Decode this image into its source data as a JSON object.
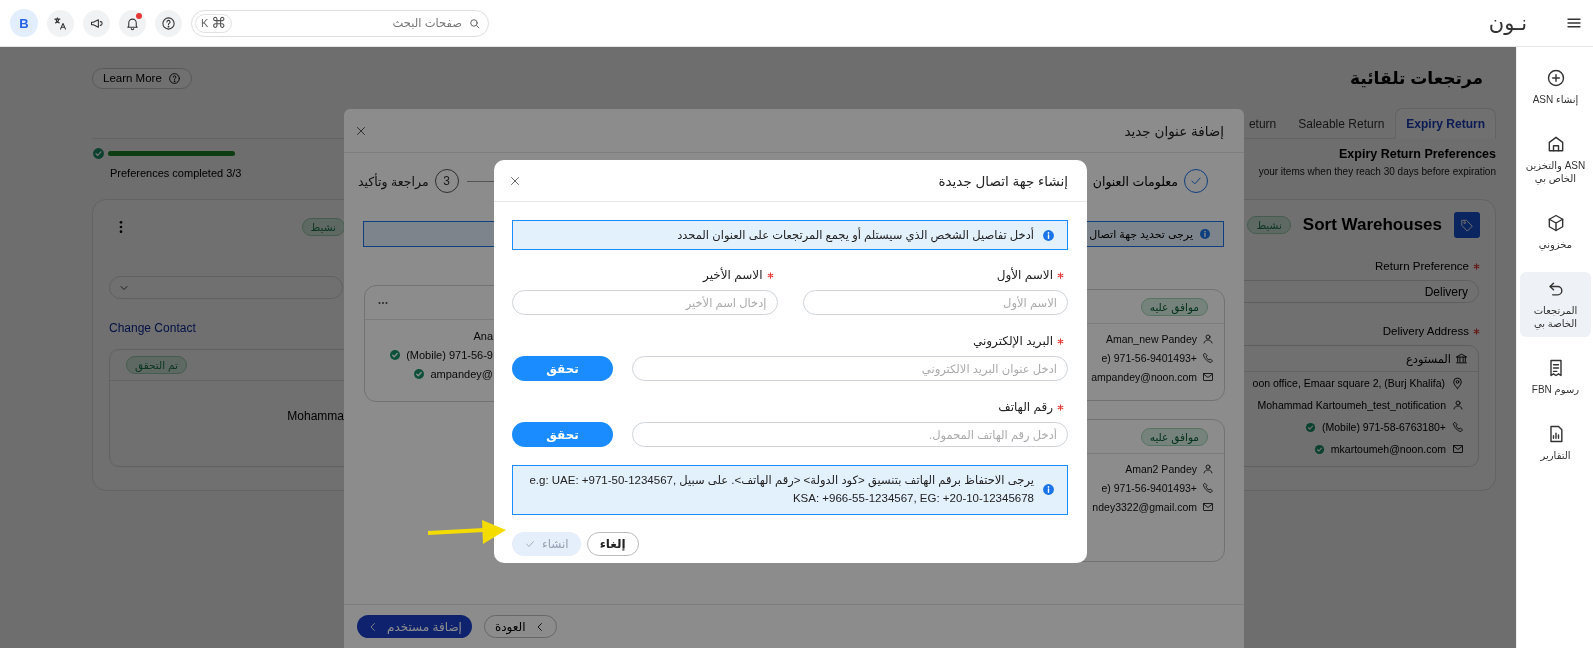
{
  "topbar": {
    "logo": "نـون",
    "search": {
      "placeholder": "صفحات البحث",
      "shortcut_symbol": "⌘",
      "shortcut_key": "K"
    },
    "notifications": {
      "unread": true
    },
    "avatar": "B"
  },
  "sidebar": {
    "items": [
      {
        "label": "إنشاء ASN",
        "selected": false
      },
      {
        "label": "ASN والتخزين الخاص بي",
        "selected": false
      },
      {
        "label": "مخزوني",
        "selected": false
      },
      {
        "label": "المرتجعات الخاصة بي",
        "selected": true
      },
      {
        "label": "رسوم FBN",
        "selected": false
      },
      {
        "label": "التقارير",
        "selected": false
      }
    ]
  },
  "page": {
    "title": "مرتجعات تلقائية",
    "learn_more": "Learn More",
    "tabs": [
      {
        "label": "Expiry Return",
        "selected": true
      },
      {
        "label": "Saleable Return",
        "selected": false
      },
      {
        "label": "eturn",
        "selected": false
      }
    ],
    "progress": {
      "level": 1,
      "label": "Preferences completed 3/3"
    },
    "section": {
      "title": "Expiry Return Preferences",
      "subtitle": "your items when they reach 30 days before expiration"
    },
    "left_panel": {
      "status": "نشيط",
      "change_contact": "Change Contact",
      "contact": {
        "badge": "تم التحقق",
        "name": "Mohamma"
      }
    },
    "warehouse": {
      "name": "Sort Warehouses",
      "status": "نشيط",
      "return_preference": {
        "label": "Return Preference",
        "required": true,
        "value": "Delivery"
      },
      "delivery_address": {
        "label": "Delivery Address",
        "required": true,
        "type": "المستودع",
        "address": "oon office, Emaar square 2, (Burj Khalifa)",
        "contact_name": "Mohammad Kartoumeh_test_notification",
        "phone": "(Mobile) 971-58-6763180+",
        "phone_verified": true,
        "email": "mkartoumeh@noon.com",
        "email_verified": true
      }
    }
  },
  "address_dialog": {
    "title": "إضافة عنوان جديد",
    "steps": [
      {
        "label": "معلومات العنوان",
        "done": true
      },
      {
        "number": "3",
        "label": "مراجعة وتأكيد",
        "done": false
      }
    ],
    "notice": "يرجى تحديد جهة اتصال",
    "left_contact": {
      "name": "Ana",
      "phone": "(Mobile) 971-56-9",
      "phone_verified": true,
      "email": "ampandey@",
      "email_verified": true
    },
    "contact_cards": [
      {
        "badge": "موافق عليه",
        "name": "Aman_new Pandey",
        "phone": "e) 971-56-9401493+",
        "email": "ampandey@noon.com"
      },
      {
        "badge": "موافق عليه",
        "name": "Aman2 Pandey",
        "phone": "e) 971-56-9401493+",
        "email": "ndey3322@gmail.com"
      }
    ],
    "buttons": {
      "add_user": "إضافة مستخدم",
      "back": "العودة"
    }
  },
  "contact_dialog": {
    "title": "إنشاء جهة اتصال جديدة",
    "notice": "أدخل تفاصيل الشخص الذي سيستلم أو يجمع المرتجعات على العنوان المحدد",
    "fields": [
      {
        "kind": "text",
        "label": "الاسم الأول",
        "required": true,
        "placeholder": "الاسم الأول"
      },
      {
        "kind": "text",
        "label": "الاسم الأخير",
        "required": true,
        "placeholder": "إدخال اسم الأخير"
      },
      {
        "kind": "verify",
        "label": "البريد الإلكتروني",
        "required": true,
        "placeholder": "ادخل عنوان البريد الالكتروني",
        "button": "تحقق"
      },
      {
        "kind": "verify",
        "label": "رقم الهاتف",
        "required": true,
        "placeholder": "أدخل رقم الهاتف المحمول.",
        "button": "تحقق"
      }
    ],
    "phone_hint": "يرجى الاحتفاظ برقم الهاتف بتنسيق <كود الدولة> <رقم الهاتف>. على سبيل e.g: UAE: +971-50-1234567, KSA: +966-55-1234567, EG: +20-10-12345678",
    "buttons": [
      {
        "kind": "secondary",
        "label": "إلغاء",
        "disabled": false
      },
      {
        "kind": "primary",
        "label": "انشاء",
        "disabled": true
      }
    ]
  }
}
